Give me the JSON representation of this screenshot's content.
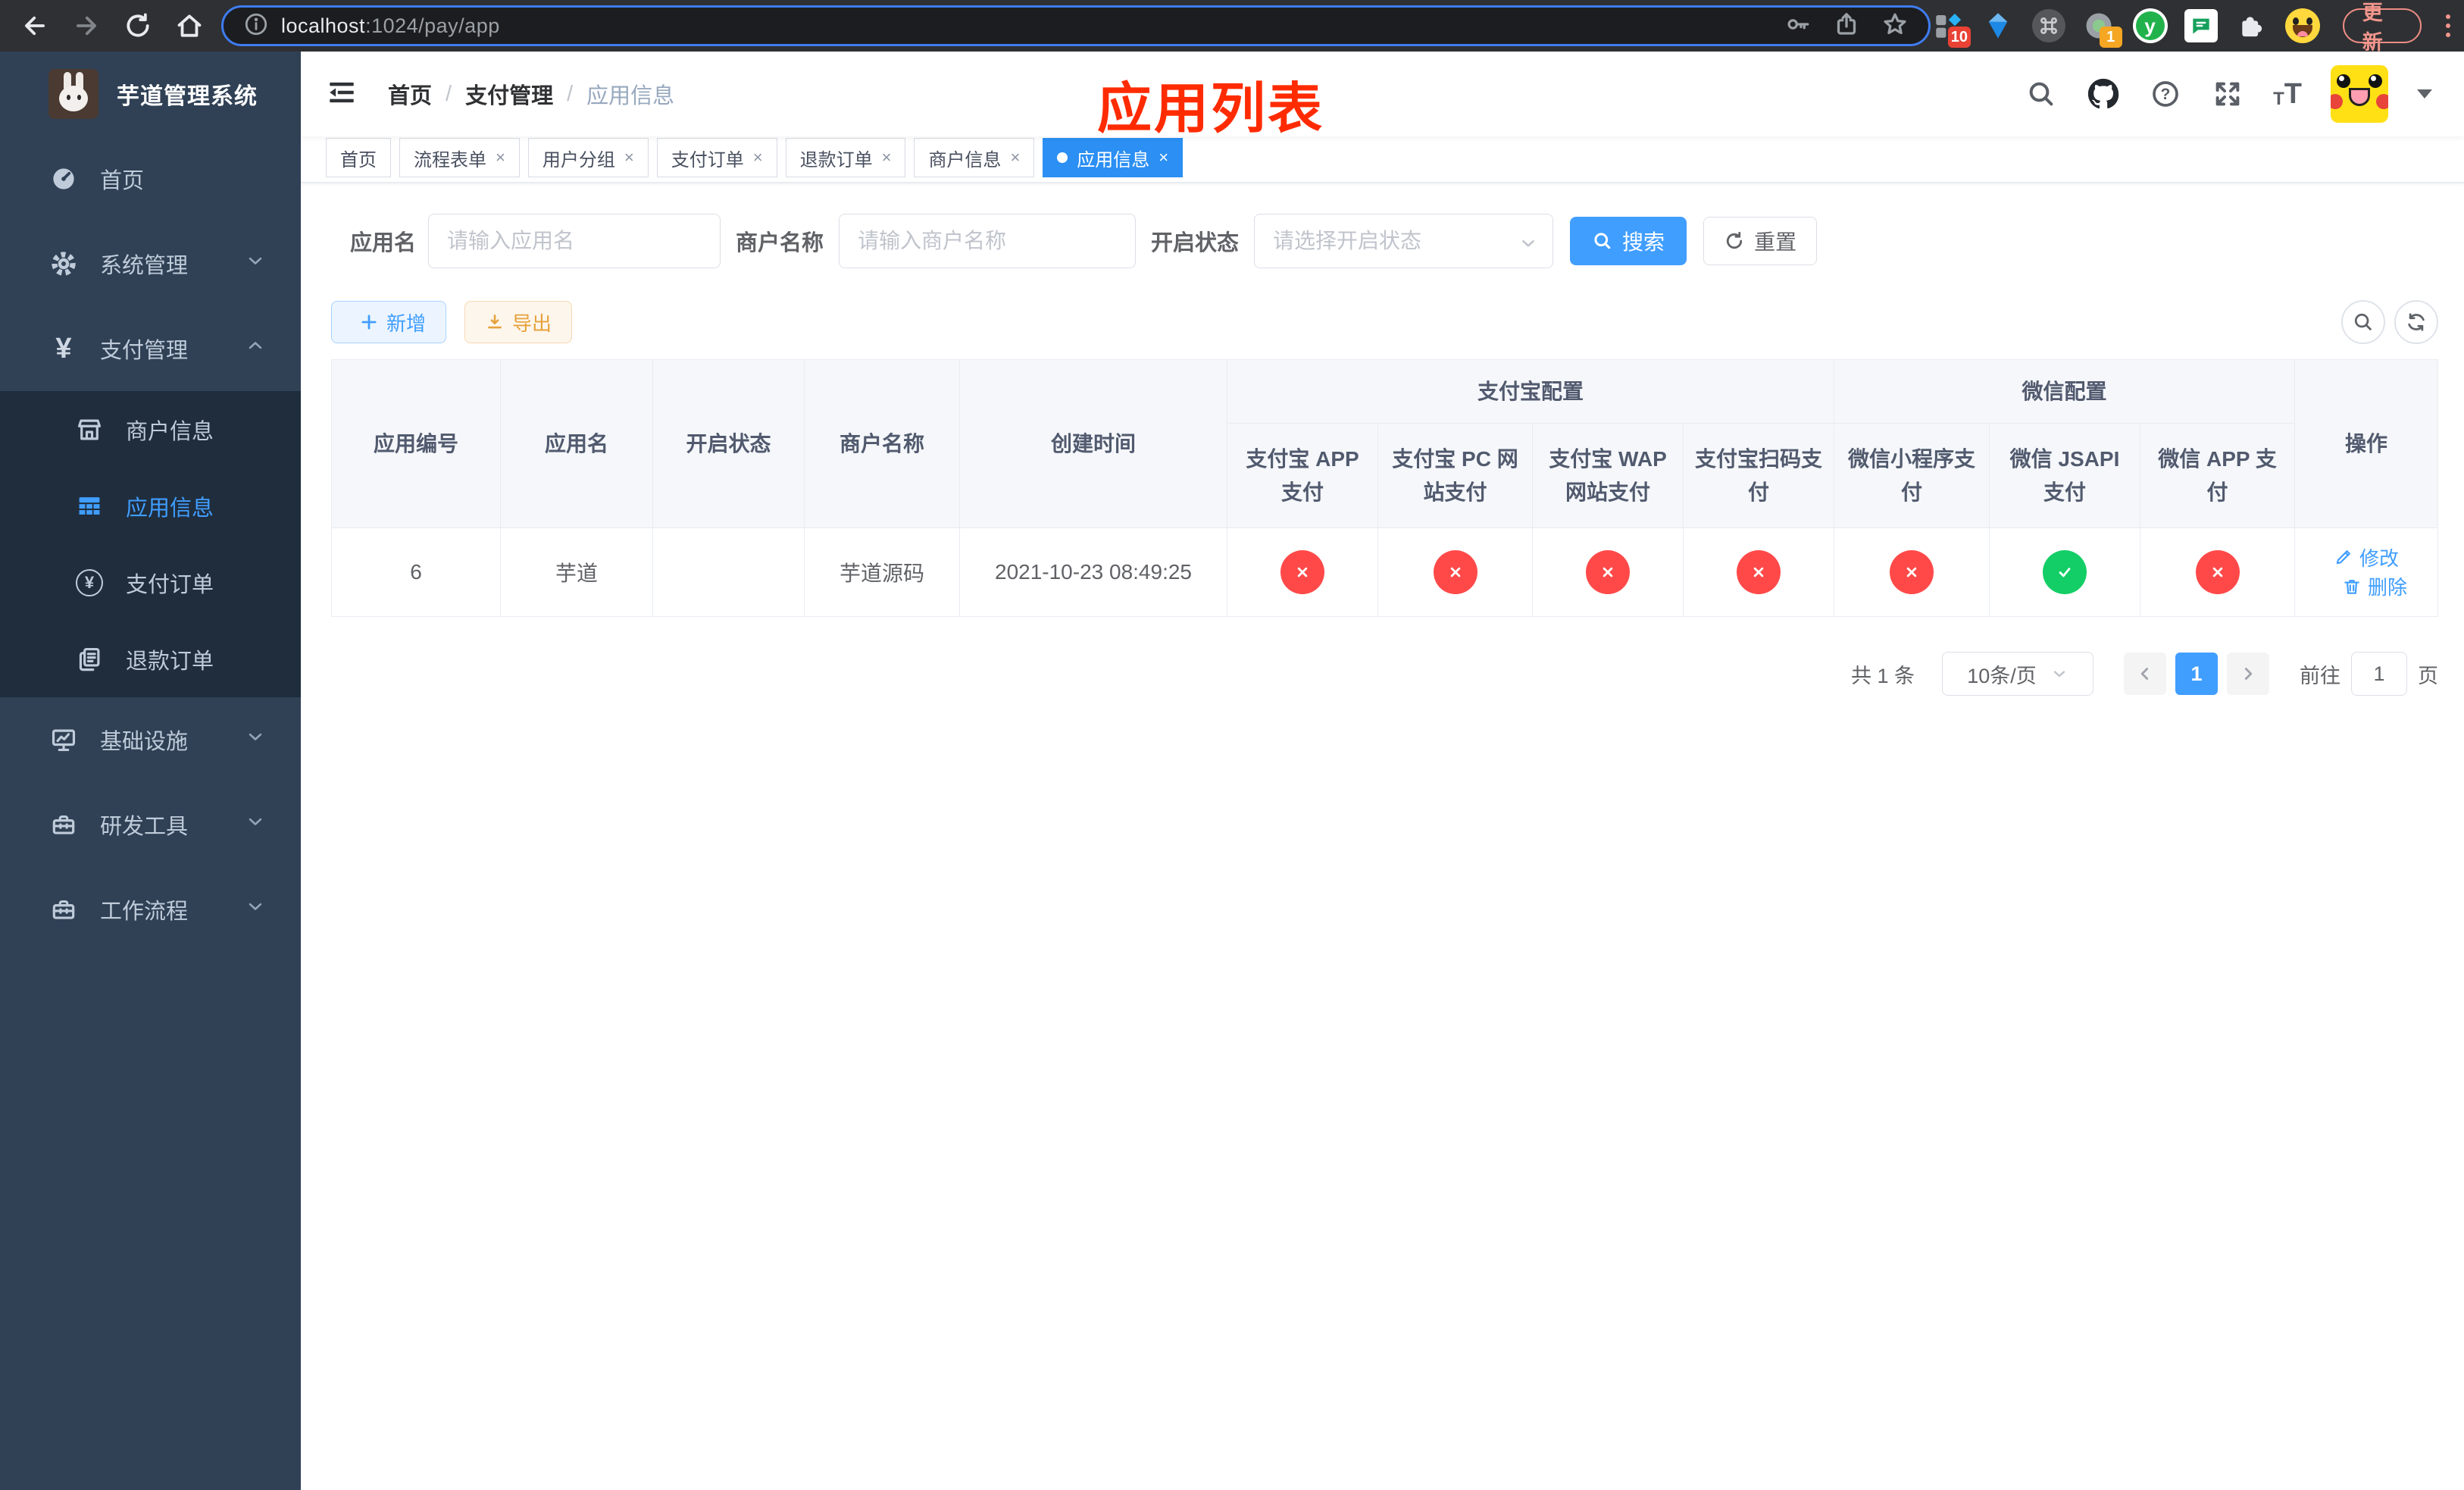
{
  "browser": {
    "url_host": "localhost",
    "url_rest": ":1024/pay/app",
    "update_label": "更新",
    "ext_badges": {
      "collections": "10",
      "status": "1"
    }
  },
  "icons": {
    "yen": "¥",
    "plus": "+",
    "question": "?",
    "y_logo": "y",
    "font_small": "T",
    "font_big": "T"
  },
  "glyphs": {
    "close": "×"
  },
  "sidebar": {
    "title": "芋道管理系统",
    "items": [
      {
        "label": "首页"
      },
      {
        "label": "系统管理"
      },
      {
        "label": "支付管理"
      },
      {
        "label": "基础设施"
      },
      {
        "label": "研发工具"
      },
      {
        "label": "工作流程"
      }
    ],
    "submenu": [
      {
        "label": "商户信息",
        "active": false
      },
      {
        "label": "应用信息",
        "active": true
      },
      {
        "label": "支付订单",
        "active": false
      },
      {
        "label": "退款订单",
        "active": false
      }
    ]
  },
  "navbar": {
    "breadcrumb": [
      "首页",
      "支付管理",
      "应用信息"
    ],
    "separator": "/"
  },
  "annotation": "应用列表",
  "tabs": [
    {
      "label": "首页",
      "closable": false,
      "active": false
    },
    {
      "label": "流程表单",
      "closable": true,
      "active": false
    },
    {
      "label": "用户分组",
      "closable": true,
      "active": false
    },
    {
      "label": "支付订单",
      "closable": true,
      "active": false
    },
    {
      "label": "退款订单",
      "closable": true,
      "active": false
    },
    {
      "label": "商户信息",
      "closable": true,
      "active": false
    },
    {
      "label": "应用信息",
      "closable": true,
      "active": true
    }
  ],
  "filters": {
    "app_name_label": "应用名",
    "app_name_placeholder": "请输入应用名",
    "merchant_label": "商户名称",
    "merchant_placeholder": "请输入商户名称",
    "status_label": "开启状态",
    "status_placeholder": "请选择开启状态",
    "search_label": "搜索",
    "reset_label": "重置"
  },
  "toolbar": {
    "add_label": "新增",
    "export_label": "导出"
  },
  "table": {
    "headers": {
      "app_id": "应用编号",
      "app_name": "应用名",
      "enabled": "开启状态",
      "merchant": "商户名称",
      "created": "创建时间",
      "alipay_group": "支付宝配置",
      "wechat_group": "微信配置",
      "alipay_app": "支付宝 APP 支付",
      "alipay_pc": "支付宝 PC 网站支付",
      "alipay_wap": "支付宝 WAP 网站支付",
      "alipay_qr": "支付宝扫码支付",
      "wechat_lite": "微信小程序支付",
      "wechat_jsapi": "微信 JSAPI 支付",
      "wechat_app": "微信 APP 支付",
      "actions": "操作"
    },
    "rows": [
      {
        "app_id": "6",
        "app_name": "芋道",
        "enabled": true,
        "merchant": "芋道源码",
        "created": "2021-10-23 08:49:25",
        "alipay_app": false,
        "alipay_pc": false,
        "alipay_wap": false,
        "alipay_qr": false,
        "wechat_lite": false,
        "wechat_jsapi": true,
        "wechat_app": false,
        "edit_label": "修改",
        "delete_label": "删除"
      }
    ]
  },
  "pagination": {
    "total": "共 1 条",
    "page_size": "10条/页",
    "current_page": "1",
    "goto_label": "前往",
    "goto_value": "1",
    "page_unit": "页"
  },
  "colors": {
    "primary": "#409EFF",
    "success": "#13CE66",
    "danger": "#FF4949",
    "warning": "#E6A23C",
    "sidebar_bg": "#304156",
    "submenu_bg": "#1F2D3D",
    "annotation_red": "#FF2B00",
    "active_tab": "#2B8FF3"
  }
}
